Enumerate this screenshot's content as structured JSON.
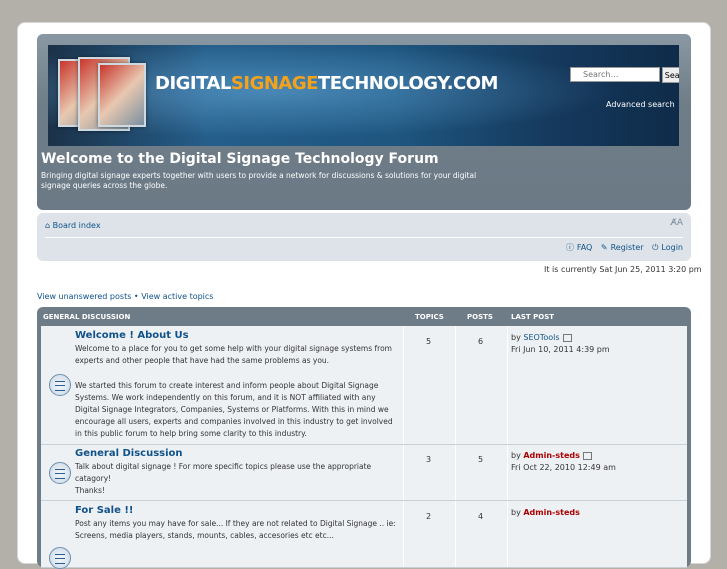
{
  "header": {
    "logo_text_a": "DIGITAL",
    "logo_text_b": "SIGNAGE",
    "logo_text_c": "TECHNOLOGY.COM",
    "search_placeholder": "Search…",
    "search_button": "Search",
    "advanced_search": "Advanced search",
    "site_title": "Welcome to the Digital Signage Technology Forum",
    "site_description": "Bringing digital signage experts together with users to provide a network for discussions & solutions for your digital signage queries across the globe."
  },
  "navbar": {
    "board_index": "Board index",
    "faq": "FAQ",
    "register": "Register",
    "login": "Login"
  },
  "current_time": "It is currently Sat Jun 25, 2011 3:20 pm",
  "view_links": {
    "unanswered": "View unanswered posts",
    "separator": " • ",
    "active": "View active topics"
  },
  "forum_table": {
    "category": "GENERAL DISCUSSION",
    "col_topics": "TOPICS",
    "col_posts": "POSTS",
    "col_last_post": "LAST POST",
    "rows": [
      {
        "title": "Welcome ! About Us",
        "description": "Welcome to a place for you to get some help with your digital signage systems from experts and other people that have had the same problems as you.",
        "description2": "We started this forum to create interest and inform people about Digital Signage Systems. We work independently on this forum, and it is NOT affiliated with any Digital Signage Integrators, Companies, Systems or Platforms. With this in mind we encourage all users, experts and companies involved in this industry to get involved in this public forum to help bring some clarity to this industry.",
        "topics": "5",
        "posts": "6",
        "lp_by": "by",
        "lp_author": "SEOTools",
        "lp_date": "Fri Jun 10, 2011 4:39 pm"
      },
      {
        "title": "General Discussion",
        "description": "Talk about digital signage ! For more specific topics please use the appropriate catagory!",
        "description2": "Thanks!",
        "topics": "3",
        "posts": "5",
        "lp_by": "by",
        "lp_author": "Admin-steds",
        "lp_date": "Fri Oct 22, 2010 12:49 am"
      },
      {
        "title": "For Sale !!",
        "description": "Post any items you may have for sale... If they are not related to Digital Signage .. ie: Screens, media players, stands, mounts, cables, accesories etc etc...",
        "topics": "2",
        "posts": "4",
        "lp_by": "by",
        "lp_author": "Admin-steds"
      }
    ]
  }
}
